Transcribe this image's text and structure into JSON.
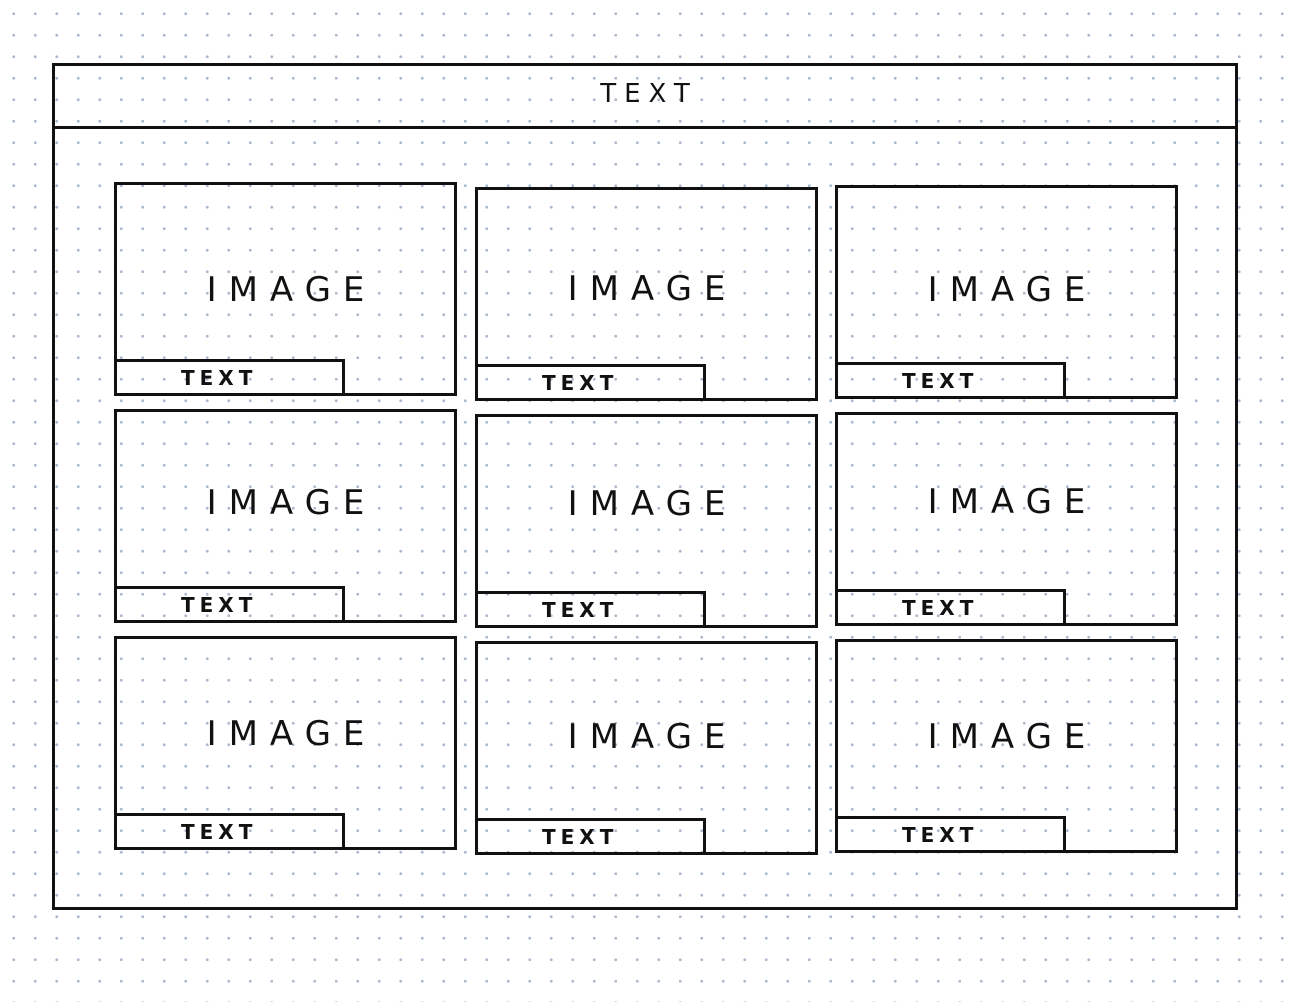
{
  "header": {
    "text": "TEXT"
  },
  "cards": [
    {
      "image_label": "IMAGE",
      "caption": "TEXT"
    },
    {
      "image_label": "IMAGE",
      "caption": "TEXT"
    },
    {
      "image_label": "IMAGE",
      "caption": "TEXT"
    },
    {
      "image_label": "IMAGE",
      "caption": "TEXT"
    },
    {
      "image_label": "IMAGE",
      "caption": "TEXT"
    },
    {
      "image_label": "IMAGE",
      "caption": "TEXT"
    },
    {
      "image_label": "IMAGE",
      "caption": "TEXT"
    },
    {
      "image_label": "IMAGE",
      "caption": "TEXT"
    },
    {
      "image_label": "IMAGE",
      "caption": "TEXT"
    }
  ]
}
